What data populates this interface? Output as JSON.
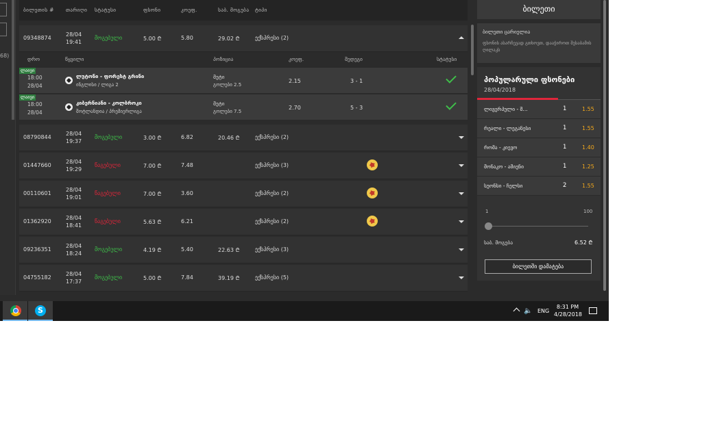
{
  "left_panel": {
    "partial_number": "68)"
  },
  "table": {
    "headers": [
      "ბილეთის #",
      "თარიღი",
      "სტატუსი",
      "ფსონი",
      "კოეფ.",
      "საბ. მოგება",
      "ტიპი"
    ],
    "rows": [
      {
        "id": "09348874",
        "date": "28/04",
        "time": "19:41",
        "status": "მოგებული",
        "status_kind": "won",
        "stake": "5.00 ₾",
        "coef": "5.80",
        "win": "29.02 ₾",
        "type": "ექსპრესი (2)",
        "expanded": true
      },
      {
        "id": "08790844",
        "date": "28/04",
        "time": "19:37",
        "status": "მოგებული",
        "status_kind": "won",
        "stake": "3.00 ₾",
        "coef": "6.82",
        "win": "20.46 ₾",
        "type": "ექსპრესი (2)"
      },
      {
        "id": "01447660",
        "date": "28/04",
        "time": "19:29",
        "status": "წაგებული",
        "status_kind": "lost",
        "stake": "7.00 ₾",
        "coef": "7.48",
        "win": "",
        "type": "ექსპრესი (3)",
        "icon": "lemon-icon"
      },
      {
        "id": "00110601",
        "date": "28/04",
        "time": "19:01",
        "status": "წაგებული",
        "status_kind": "lost",
        "stake": "7.00 ₾",
        "coef": "3.60",
        "win": "",
        "type": "ექსპრესი (2)",
        "icon": "lemon-icon"
      },
      {
        "id": "01362920",
        "date": "28/04",
        "time": "18:41",
        "status": "წაგებული",
        "status_kind": "lost",
        "stake": "5.63 ₾",
        "coef": "6.21",
        "win": "",
        "type": "ექსპრესი (2)",
        "icon": "lemon-icon"
      },
      {
        "id": "09236351",
        "date": "28/04",
        "time": "18:24",
        "status": "მოგებული",
        "status_kind": "won",
        "stake": "4.19 ₾",
        "coef": "5.40",
        "win": "22.63 ₾",
        "type": "ექსპრესი (3)"
      },
      {
        "id": "04755182",
        "date": "28/04",
        "time": "17:37",
        "status": "მოგებული",
        "status_kind": "won",
        "stake": "5.00 ₾",
        "coef": "7.84",
        "win": "39.19 ₾",
        "type": "ექსპრესი (5)"
      }
    ]
  },
  "details": {
    "headers": [
      "დრო",
      "წყვილი",
      "პოზიცია",
      "კოეფ.",
      "შედეგი",
      "სტატუსი"
    ],
    "events": [
      {
        "live": "ლაივი",
        "time": "18:00",
        "date": "28/04",
        "match": "ლუტონი - ფორესტ გრინი",
        "league": "ინგლისი / ლიგა 2",
        "pos1": "მეტი",
        "pos2": "გოლები 2.5",
        "coef": "2.15",
        "result": "3 - 1"
      },
      {
        "live": "ლაივი",
        "time": "18:00",
        "date": "28/04",
        "match": "კიბერნიანი - კოლბროკი",
        "league": "შოტლანდია / პრემიერლიგა",
        "pos1": "მეტი",
        "pos2": "გოლები 7.5",
        "coef": "2.70",
        "result": "5 - 3"
      }
    ]
  },
  "ticket_panel": {
    "title": "ბილეთი",
    "empty_title": "ბილეთი ცარიელია",
    "empty_text": "ფსონის ასარჩევად გთხოვთ, დააჭიროთ შესაბამის ღილაკს",
    "popular_title": "პოპულარული ფსონები",
    "popular_date": "28/04/2018",
    "popular": [
      {
        "name": "ლივერპული - შ...",
        "result": "1",
        "odds": "1.55"
      },
      {
        "name": "რეალი - ლეგანესი",
        "result": "1",
        "odds": "1.55"
      },
      {
        "name": "რომა - კიევო",
        "result": "1",
        "odds": "1.40"
      },
      {
        "name": "მონაკო - ამიენი",
        "result": "1",
        "odds": "1.25"
      },
      {
        "name": "სუონსი - ჩელსი",
        "result": "2",
        "odds": "1.55"
      }
    ],
    "slider_min": "1",
    "slider_max": "100",
    "slider_value": 1,
    "possible_win_label": "საბ. მოგება",
    "possible_win_value": "6.52 ₾",
    "add_button": "ბილეთში დამატება"
  },
  "taskbar": {
    "apps": [
      "chrome-icon",
      "skype-icon"
    ],
    "language": "ENG",
    "time": "8:31 PM",
    "date": "4/28/2018"
  }
}
